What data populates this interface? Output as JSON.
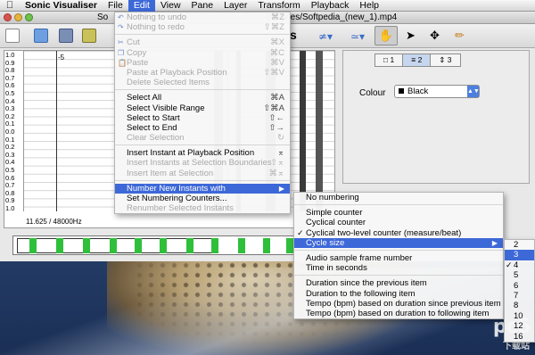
{
  "menubar": {
    "apple": "",
    "app": "Sonic Visualiser",
    "items": [
      "File",
      "Edit",
      "View",
      "Pane",
      "Layer",
      "Transform",
      "Playback",
      "Help"
    ],
    "active": "Edit"
  },
  "window": {
    "title_left": "So",
    "title_right": "t/Movies/Softpedia_(new_1).mp4"
  },
  "toolbar": {
    "s_label": "s"
  },
  "pane": {
    "scale_ticks": [
      "1.0",
      "0.9",
      "0.8",
      "0.7",
      "0.6",
      "0.5",
      "0.4",
      "0.3",
      "0.2",
      "0.1",
      "0.0",
      "0.1",
      "0.2",
      "0.3",
      "0.4",
      "0.5",
      "0.6",
      "0.7",
      "0.8",
      "0.9",
      "1.0"
    ],
    "instant_label": "-5",
    "info": "11.625 / 48000Hz"
  },
  "properties": {
    "tabs": [
      "1",
      "2",
      "3"
    ],
    "colour_label": "Colour",
    "colour_value": "Black"
  },
  "edit_menu": {
    "items": [
      {
        "label": "Nothing to undo",
        "sc": "⌘Z",
        "disabled": true,
        "icon": "undo"
      },
      {
        "label": "Nothing to redo",
        "sc": "⇧⌘Z",
        "disabled": true,
        "icon": "redo"
      },
      {
        "sep": true
      },
      {
        "label": "Cut",
        "sc": "⌘X",
        "disabled": true,
        "icon": "cut"
      },
      {
        "label": "Copy",
        "sc": "⌘C",
        "disabled": true,
        "icon": "copy"
      },
      {
        "label": "Paste",
        "sc": "⌘V",
        "disabled": true,
        "icon": "paste"
      },
      {
        "label": "Paste at Playback Position",
        "sc": "⇧⌘V",
        "disabled": true
      },
      {
        "label": "Delete Selected Items",
        "sc": "",
        "disabled": true
      },
      {
        "sep": true
      },
      {
        "label": "Select All",
        "sc": "⌘A",
        "disabled": false
      },
      {
        "label": "Select Visible Range",
        "sc": "⇧⌘A",
        "disabled": false
      },
      {
        "label": "Select to Start",
        "sc": "⇧←",
        "disabled": false
      },
      {
        "label": "Select to End",
        "sc": "⇧→",
        "disabled": false
      },
      {
        "label": "Clear Selection",
        "sc": "↻",
        "disabled": true
      },
      {
        "sep": true
      },
      {
        "label": "Insert Instant at Playback Position",
        "sc": "⌅",
        "disabled": false
      },
      {
        "label": "Insert Instants at Selection Boundaries",
        "sc": "⇧⌅",
        "disabled": true
      },
      {
        "label": "Insert Item at Selection",
        "sc": "⌘⌅",
        "disabled": true
      },
      {
        "sep": true
      },
      {
        "label": "Number New Instants with",
        "sc": "",
        "disabled": false,
        "highlighted": true,
        "submenu": true
      },
      {
        "label": "Set Numbering Counters...",
        "sc": "",
        "disabled": false
      },
      {
        "label": "Renumber Selected Instants",
        "sc": "",
        "disabled": true
      }
    ]
  },
  "numbering_menu": {
    "items": [
      {
        "label": "No numbering"
      },
      {
        "sep": true
      },
      {
        "label": "Simple counter"
      },
      {
        "label": "Cyclical counter"
      },
      {
        "label": "Cyclical two-level counter (measure/beat)",
        "checked": true
      },
      {
        "label": "Cycle size",
        "highlighted": true,
        "submenu": true
      },
      {
        "sep": true
      },
      {
        "label": "Audio sample frame number"
      },
      {
        "label": "Time in seconds"
      },
      {
        "sep": true
      },
      {
        "label": "Duration since the previous item"
      },
      {
        "label": "Duration to the following item"
      },
      {
        "label": "Tempo (bpm) based on duration since previous item"
      },
      {
        "label": "Tempo (bpm) based on duration to following item"
      }
    ]
  },
  "cycle_menu": {
    "items": [
      "2",
      "3",
      "4",
      "5",
      "6",
      "7",
      "8",
      "10",
      "12",
      "16"
    ],
    "highlighted": "3",
    "checked": "4"
  },
  "watermark": {
    "main": "pc6",
    "sub": "下载站"
  },
  "colors": {
    "accent": "#3d68d8",
    "wave": "#2fbf3b"
  }
}
